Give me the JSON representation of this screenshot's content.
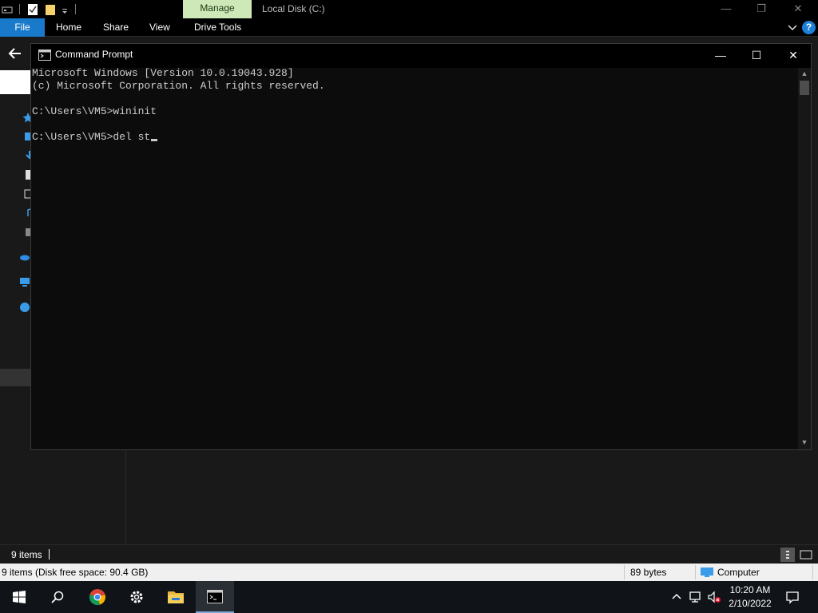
{
  "explorer": {
    "title": "Local Disk (C:)",
    "manage_tab": "Manage",
    "ribbon_tabs": [
      "File",
      "Home",
      "Share",
      "View",
      "Drive Tools"
    ],
    "help_label": "?",
    "status_items": "9 items",
    "status_details": "9 items (Disk free space: 90.4 GB)",
    "status_size": "89 bytes",
    "status_location": "Computer"
  },
  "cmd": {
    "title": "Command Prompt",
    "lines": [
      "Microsoft Windows [Version 10.0.19043.928]",
      "(c) Microsoft Corporation. All rights reserved.",
      "",
      "C:\\Users\\VM5>wininit",
      "",
      "C:\\Users\\VM5>del st"
    ]
  },
  "taskbar": {
    "apps": [
      "start-icon",
      "search-icon",
      "chrome-icon",
      "settings-icon",
      "file-explorer-icon",
      "command-prompt-icon"
    ],
    "time": "10:20 AM",
    "date": "2/10/2022"
  },
  "colors": {
    "file_tab": "#1979ca",
    "manage_tab": "#cfe8b8",
    "console_bg": "#0c0c0c",
    "console_text": "#cccccc"
  }
}
